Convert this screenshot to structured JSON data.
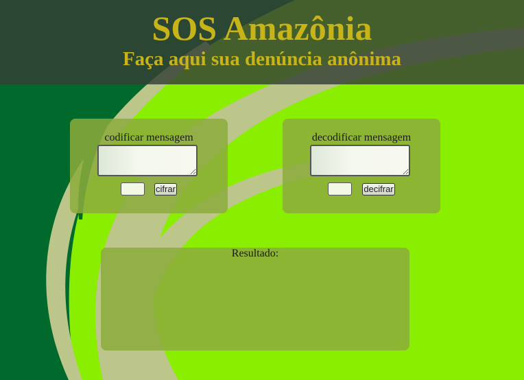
{
  "header": {
    "title": "SOS Amazônia",
    "subtitle": "Faça aqui sua denúncia anônima"
  },
  "encode_panel": {
    "label": "codificar mensagem",
    "message_value": "",
    "key_value": "",
    "button_label": "cifrar"
  },
  "decode_panel": {
    "label": "decodificar mensagem",
    "message_value": "",
    "key_value": "",
    "button_label": "decifrar"
  },
  "result": {
    "label": "Resultado:",
    "value": ""
  },
  "colors": {
    "background_light_green": "#8aee00",
    "background_dark_green": "#006a2c",
    "swoosh_beige": "#bcc58a",
    "header_overlay": "#344034",
    "title_gold": "#c8b418",
    "panel_olive": "#8cac3c"
  }
}
